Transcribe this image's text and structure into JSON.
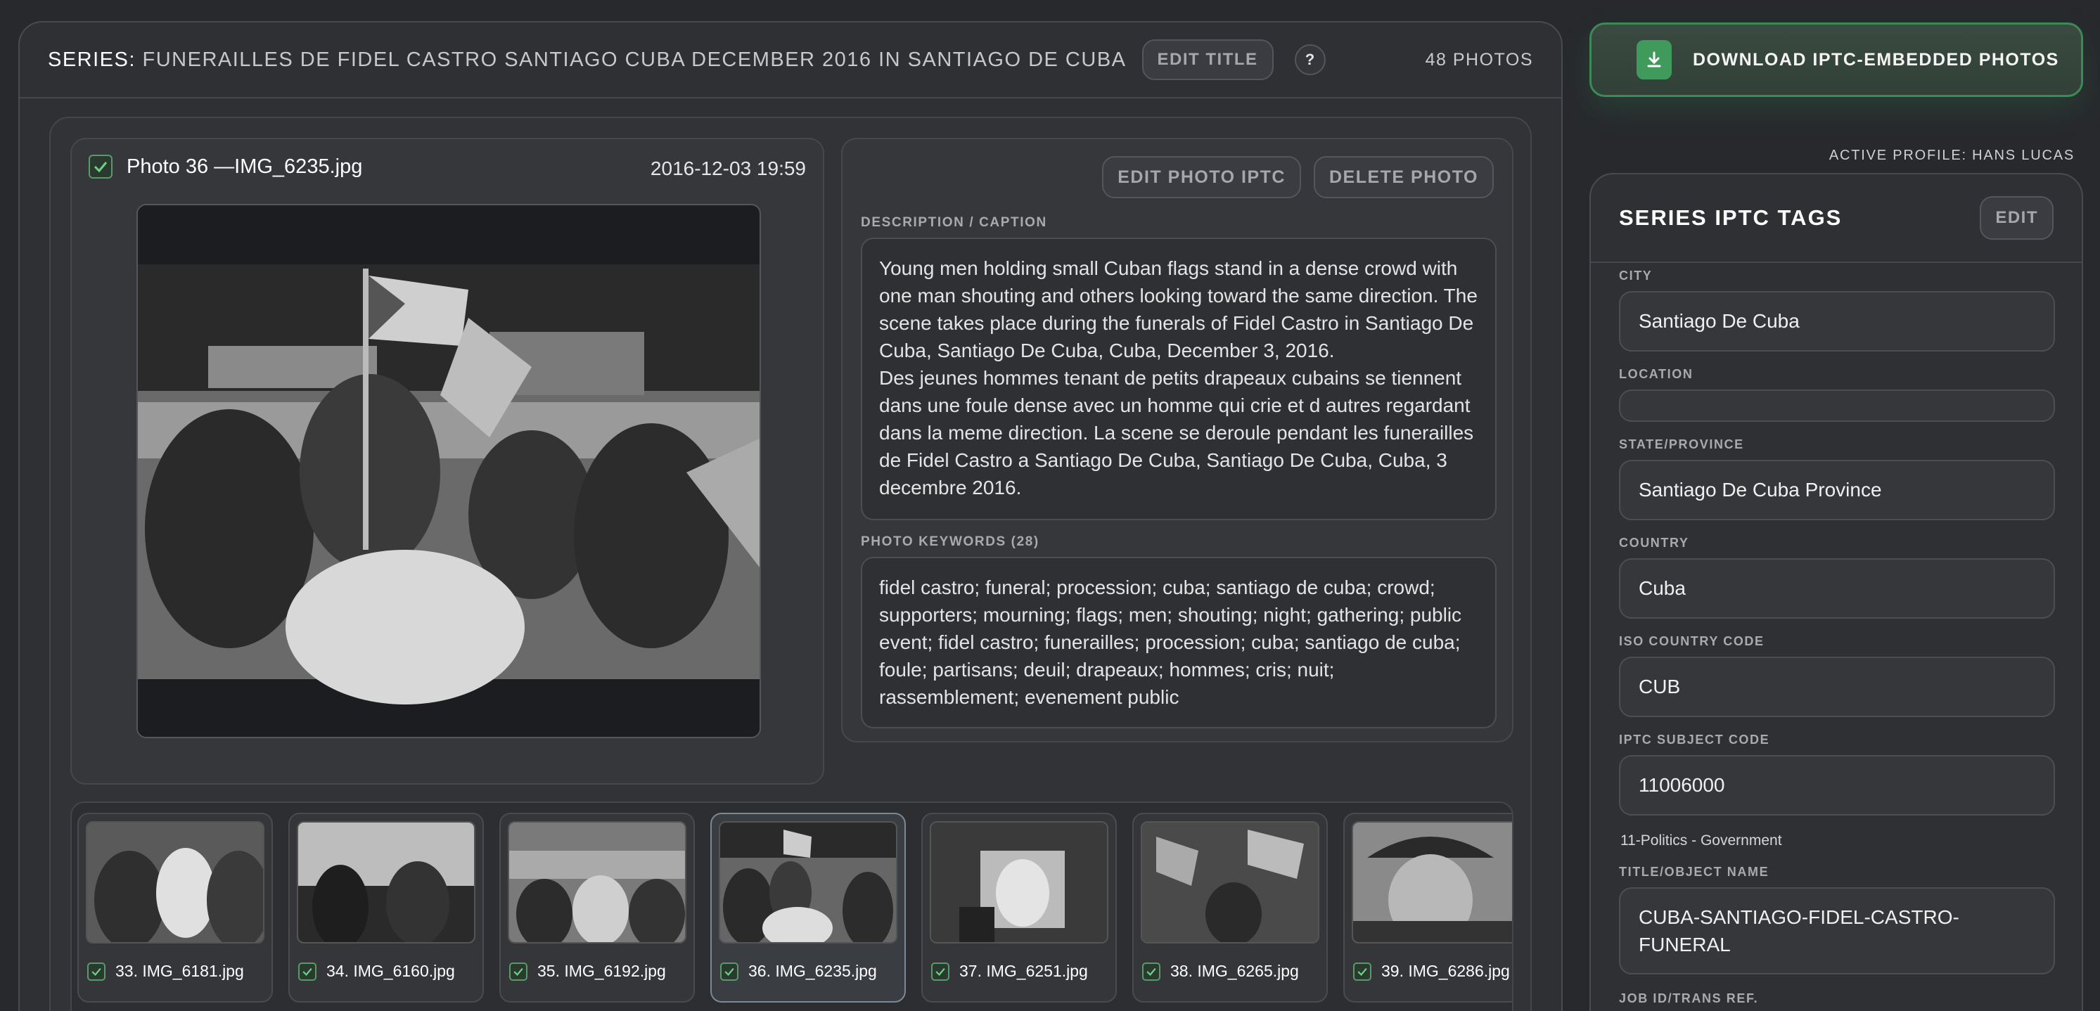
{
  "series": {
    "label": "SERIES:",
    "name": "FUNERAILLES DE FIDEL CASTRO SANTIAGO CUBA DECEMBER 2016 IN SANTIAGO DE CUBA",
    "edit_title_label": "EDIT TITLE",
    "help_label": "?",
    "photo_count": "48 PHOTOS"
  },
  "photo": {
    "title": "Photo 36 —IMG_6235.jpg",
    "date": "2016-12-03 19:59",
    "edit_iptc_label": "EDIT PHOTO IPTC",
    "delete_label": "DELETE PHOTO",
    "description_label": "DESCRIPTION / CAPTION",
    "description": "Young men holding small Cuban flags stand in a dense crowd with one man shouting and others looking toward the same direction. The scene takes place during the funerals of Fidel Castro in Santiago De Cuba, Santiago De Cuba, Cuba, December 3, 2016.\nDes jeunes hommes tenant de petits drapeaux cubains se tiennent dans une foule dense avec un homme qui crie et d autres regardant dans la meme direction. La scene se deroule pendant les funerailles de Fidel Castro a Santiago De Cuba, Santiago De Cuba, Cuba, 3 decembre 2016.",
    "keywords_label": "PHOTO KEYWORDS (28)",
    "keywords": "fidel castro; funeral; procession; cuba; santiago de cuba; crowd; supporters; mourning; flags; men; shouting; night; gathering; public event; fidel castro; funerailles; procession; cuba; santiago de cuba; foule; partisans; deuil; drapeaux; hommes; cris; nuit; rassemblement; evenement public"
  },
  "thumbnails": [
    {
      "label": "33. IMG_6181.jpg",
      "active": false
    },
    {
      "label": "34. IMG_6160.jpg",
      "active": false
    },
    {
      "label": "35. IMG_6192.jpg",
      "active": false
    },
    {
      "label": "36. IMG_6235.jpg",
      "active": true
    },
    {
      "label": "37. IMG_6251.jpg",
      "active": false
    },
    {
      "label": "38. IMG_6265.jpg",
      "active": false
    },
    {
      "label": "39. IMG_6286.jpg",
      "active": false
    }
  ],
  "download": {
    "label": "DOWNLOAD IPTC-EMBEDDED PHOTOS",
    "icon": "download-icon",
    "accent": "#3f9a5c"
  },
  "profile": "ACTIVE PROFILE: HANS LUCAS",
  "iptc": {
    "title": "SERIES IPTC TAGS",
    "edit_label": "EDIT",
    "city_label": "CITY",
    "city": "Santiago De Cuba",
    "location_label": "LOCATION",
    "location": "",
    "state_label": "STATE/PROVINCE",
    "state": "Santiago De Cuba Province",
    "country_label": "COUNTRY",
    "country": "Cuba",
    "iso_label": "ISO COUNTRY CODE",
    "iso": "CUB",
    "subject_label": "IPTC SUBJECT CODE",
    "subject": "11006000",
    "subject_note": "11-Politics - Government",
    "object_label": "TITLE/OBJECT NAME",
    "object_name": "CUBA-SANTIAGO-FIDEL-CASTRO-FUNERAL",
    "job_label": "JOB ID/TRANS REF."
  }
}
